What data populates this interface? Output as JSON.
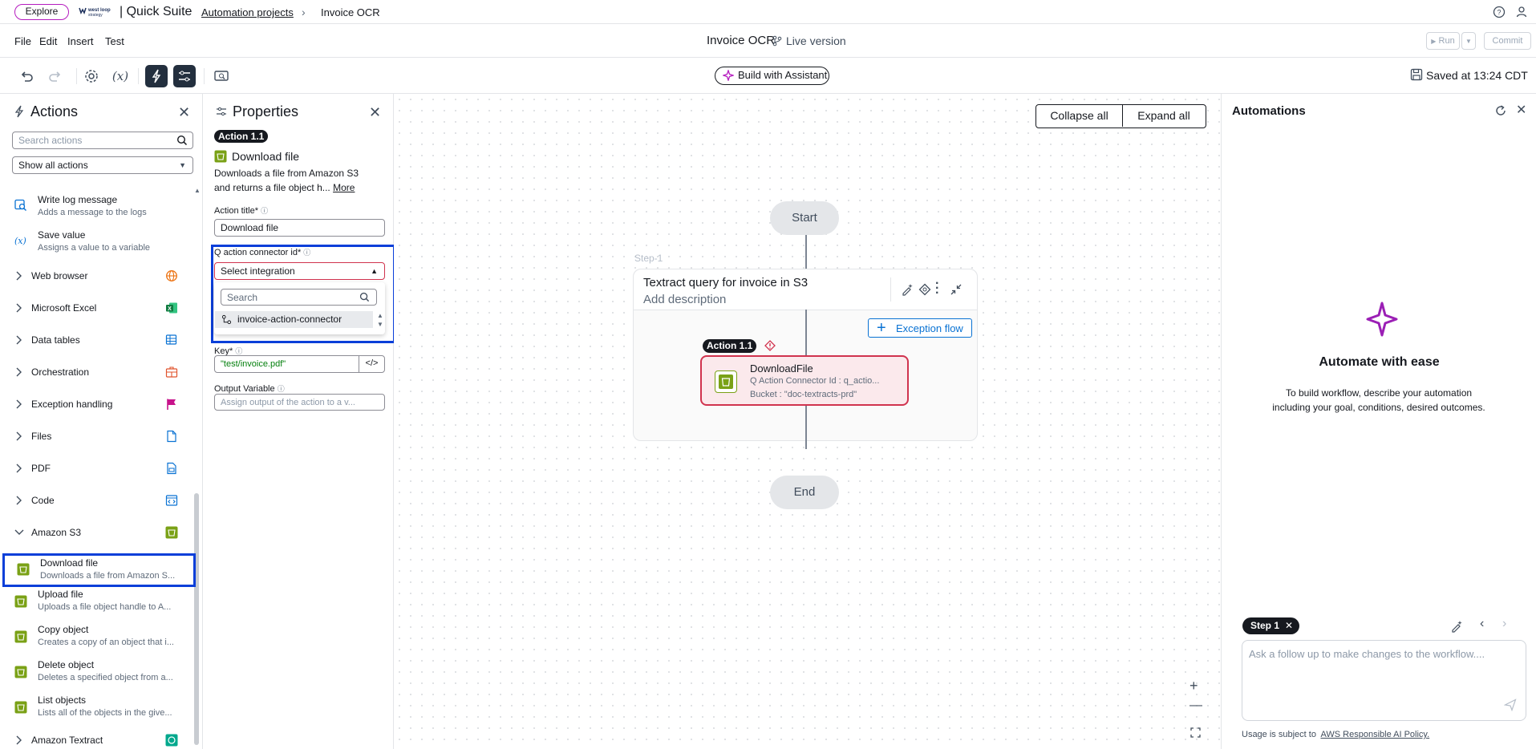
{
  "topbar": {
    "explore": "Explore",
    "logo_text": "west loop\nstrategy",
    "product": "| Quick Suite",
    "breadcrumb": [
      "Automation projects",
      "Invoice OCR"
    ],
    "help_icon": "help-icon",
    "user_icon": "user-icon"
  },
  "menu": {
    "items": [
      "File",
      "Edit",
      "Insert",
      "Test"
    ],
    "doc_title": "Invoice OCR",
    "version": "Live version",
    "run": "Run",
    "commit": "Commit"
  },
  "toolbar": {
    "build": "Build with Assistant",
    "saved": "Saved at 13:24 CDT"
  },
  "actions": {
    "title": "Actions",
    "search_placeholder": "Search actions",
    "filter": "Show all actions",
    "top_items": [
      {
        "title": "Write log message",
        "desc": "Adds a message to the logs"
      },
      {
        "title": "Save value",
        "desc": "Assigns a value to a variable"
      }
    ],
    "categories": [
      "Web browser",
      "Microsoft Excel",
      "Data tables",
      "Orchestration",
      "Exception handling",
      "Files",
      "PDF",
      "Code"
    ],
    "open_category": "Amazon S3",
    "s3_items": [
      {
        "title": "Download file",
        "desc": "Downloads a file from Amazon S..."
      },
      {
        "title": "Upload file",
        "desc": "Uploads a file object handle to A..."
      },
      {
        "title": "Copy object",
        "desc": "Creates a copy of an object that i..."
      },
      {
        "title": "Delete object",
        "desc": "Deletes a specified object from a..."
      },
      {
        "title": "List objects",
        "desc": "Lists all of the objects in the give..."
      }
    ],
    "last_category": "Amazon Textract"
  },
  "properties": {
    "title": "Properties",
    "badge": "Action 1.1",
    "action_name": "Download file",
    "description": "Downloads a file from Amazon S3 and returns a file object h...",
    "more": "More",
    "action_title_label": "Action title*",
    "action_title_value": "Download file",
    "connector_label": "Q action connector id*",
    "connector_select": "Select integration",
    "dropdown_search": "Search",
    "dropdown_option": "invoice-action-connector",
    "key_label": "Key*",
    "key_value": "\"test/invoice.pdf\"",
    "output_label": "Output Variable",
    "output_placeholder": "Assign output of the action to a v..."
  },
  "canvas": {
    "collapse_all": "Collapse all",
    "expand_all": "Expand all",
    "start": "Start",
    "end": "End",
    "step_label": "Step-1",
    "step_title": "Textract query for invoice in S3",
    "step_desc": "Add description",
    "exception_flow": "Exception flow",
    "action_badge": "Action 1.1",
    "action_title": "DownloadFile",
    "action_line1": "Q Action Connector Id : q_actio...",
    "action_line2": "Bucket : \"doc-textracts-prd\""
  },
  "automations": {
    "title": "Automations",
    "headline": "Automate with ease",
    "body": "To build workflow, describe your automation including your goal, conditions, desired outcomes.",
    "step_chip": "Step 1",
    "chat_placeholder": "Ask a follow up to make changes to the workflow....",
    "usage_prefix": "Usage is subject to",
    "usage_link": "AWS Responsible AI Policy."
  },
  "colors": {
    "accent_purple": "#b51cbf",
    "highlight_blue": "#0a3fd9",
    "error_red": "#d0334e",
    "s3_green": "#7aa116"
  }
}
